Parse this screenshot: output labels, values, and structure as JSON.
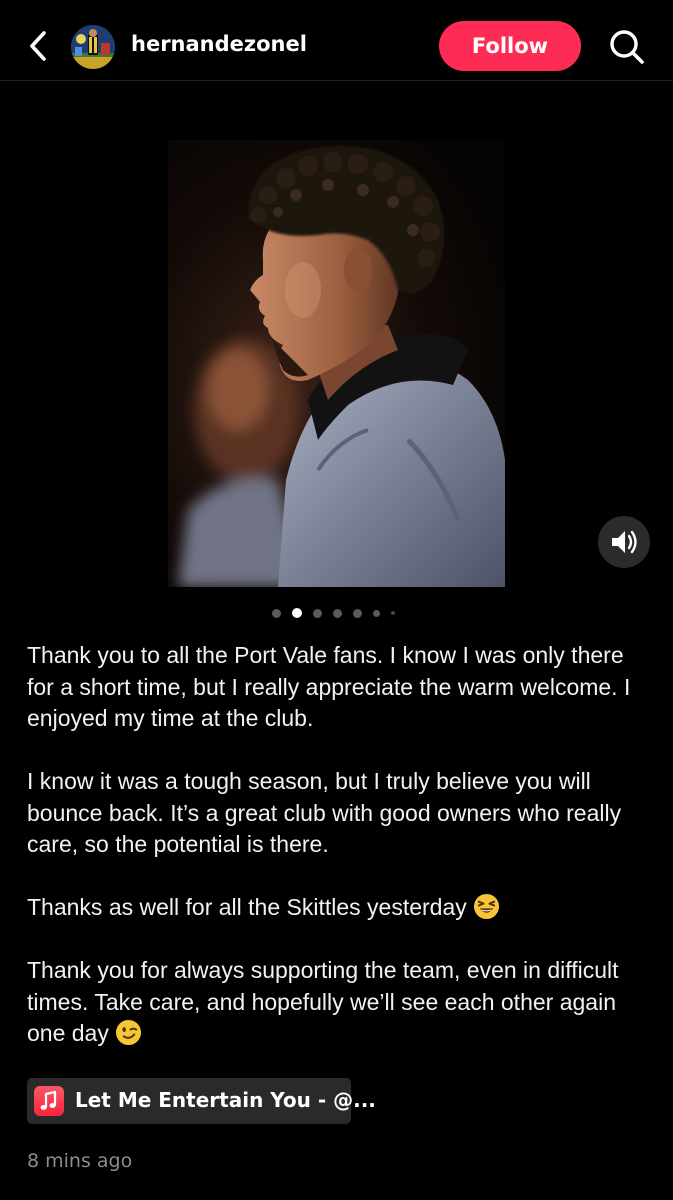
{
  "header": {
    "username": "hernandezonel",
    "follow_label": "Follow"
  },
  "icons": {
    "back": "chevron-left-icon",
    "search": "search-icon",
    "sound": "speaker-icon",
    "music": "music-note-icon"
  },
  "colors": {
    "accent": "#fe2c55",
    "music_icon": "#fb233b"
  },
  "carousel": {
    "total_dots": 7,
    "active_index": 1
  },
  "caption": {
    "p1": "Thank you to all the Port Vale fans. I know I was only there for a short time, but I really appreciate the warm welcome. I enjoyed my time at the club.",
    "p2": "I know it was a tough season, but I truly believe you will bounce back. It’s a great club with good owners who really care, so the potential is there.",
    "p3": "Thanks as well for all the Skittles yesterday",
    "p4": "Thank you for always supporting the team, even in difficult times. Take care, and hopefully we’ll see each other again one day"
  },
  "music": {
    "label": "Let Me Entertain You - @..."
  },
  "timestamp": "8 mins ago"
}
